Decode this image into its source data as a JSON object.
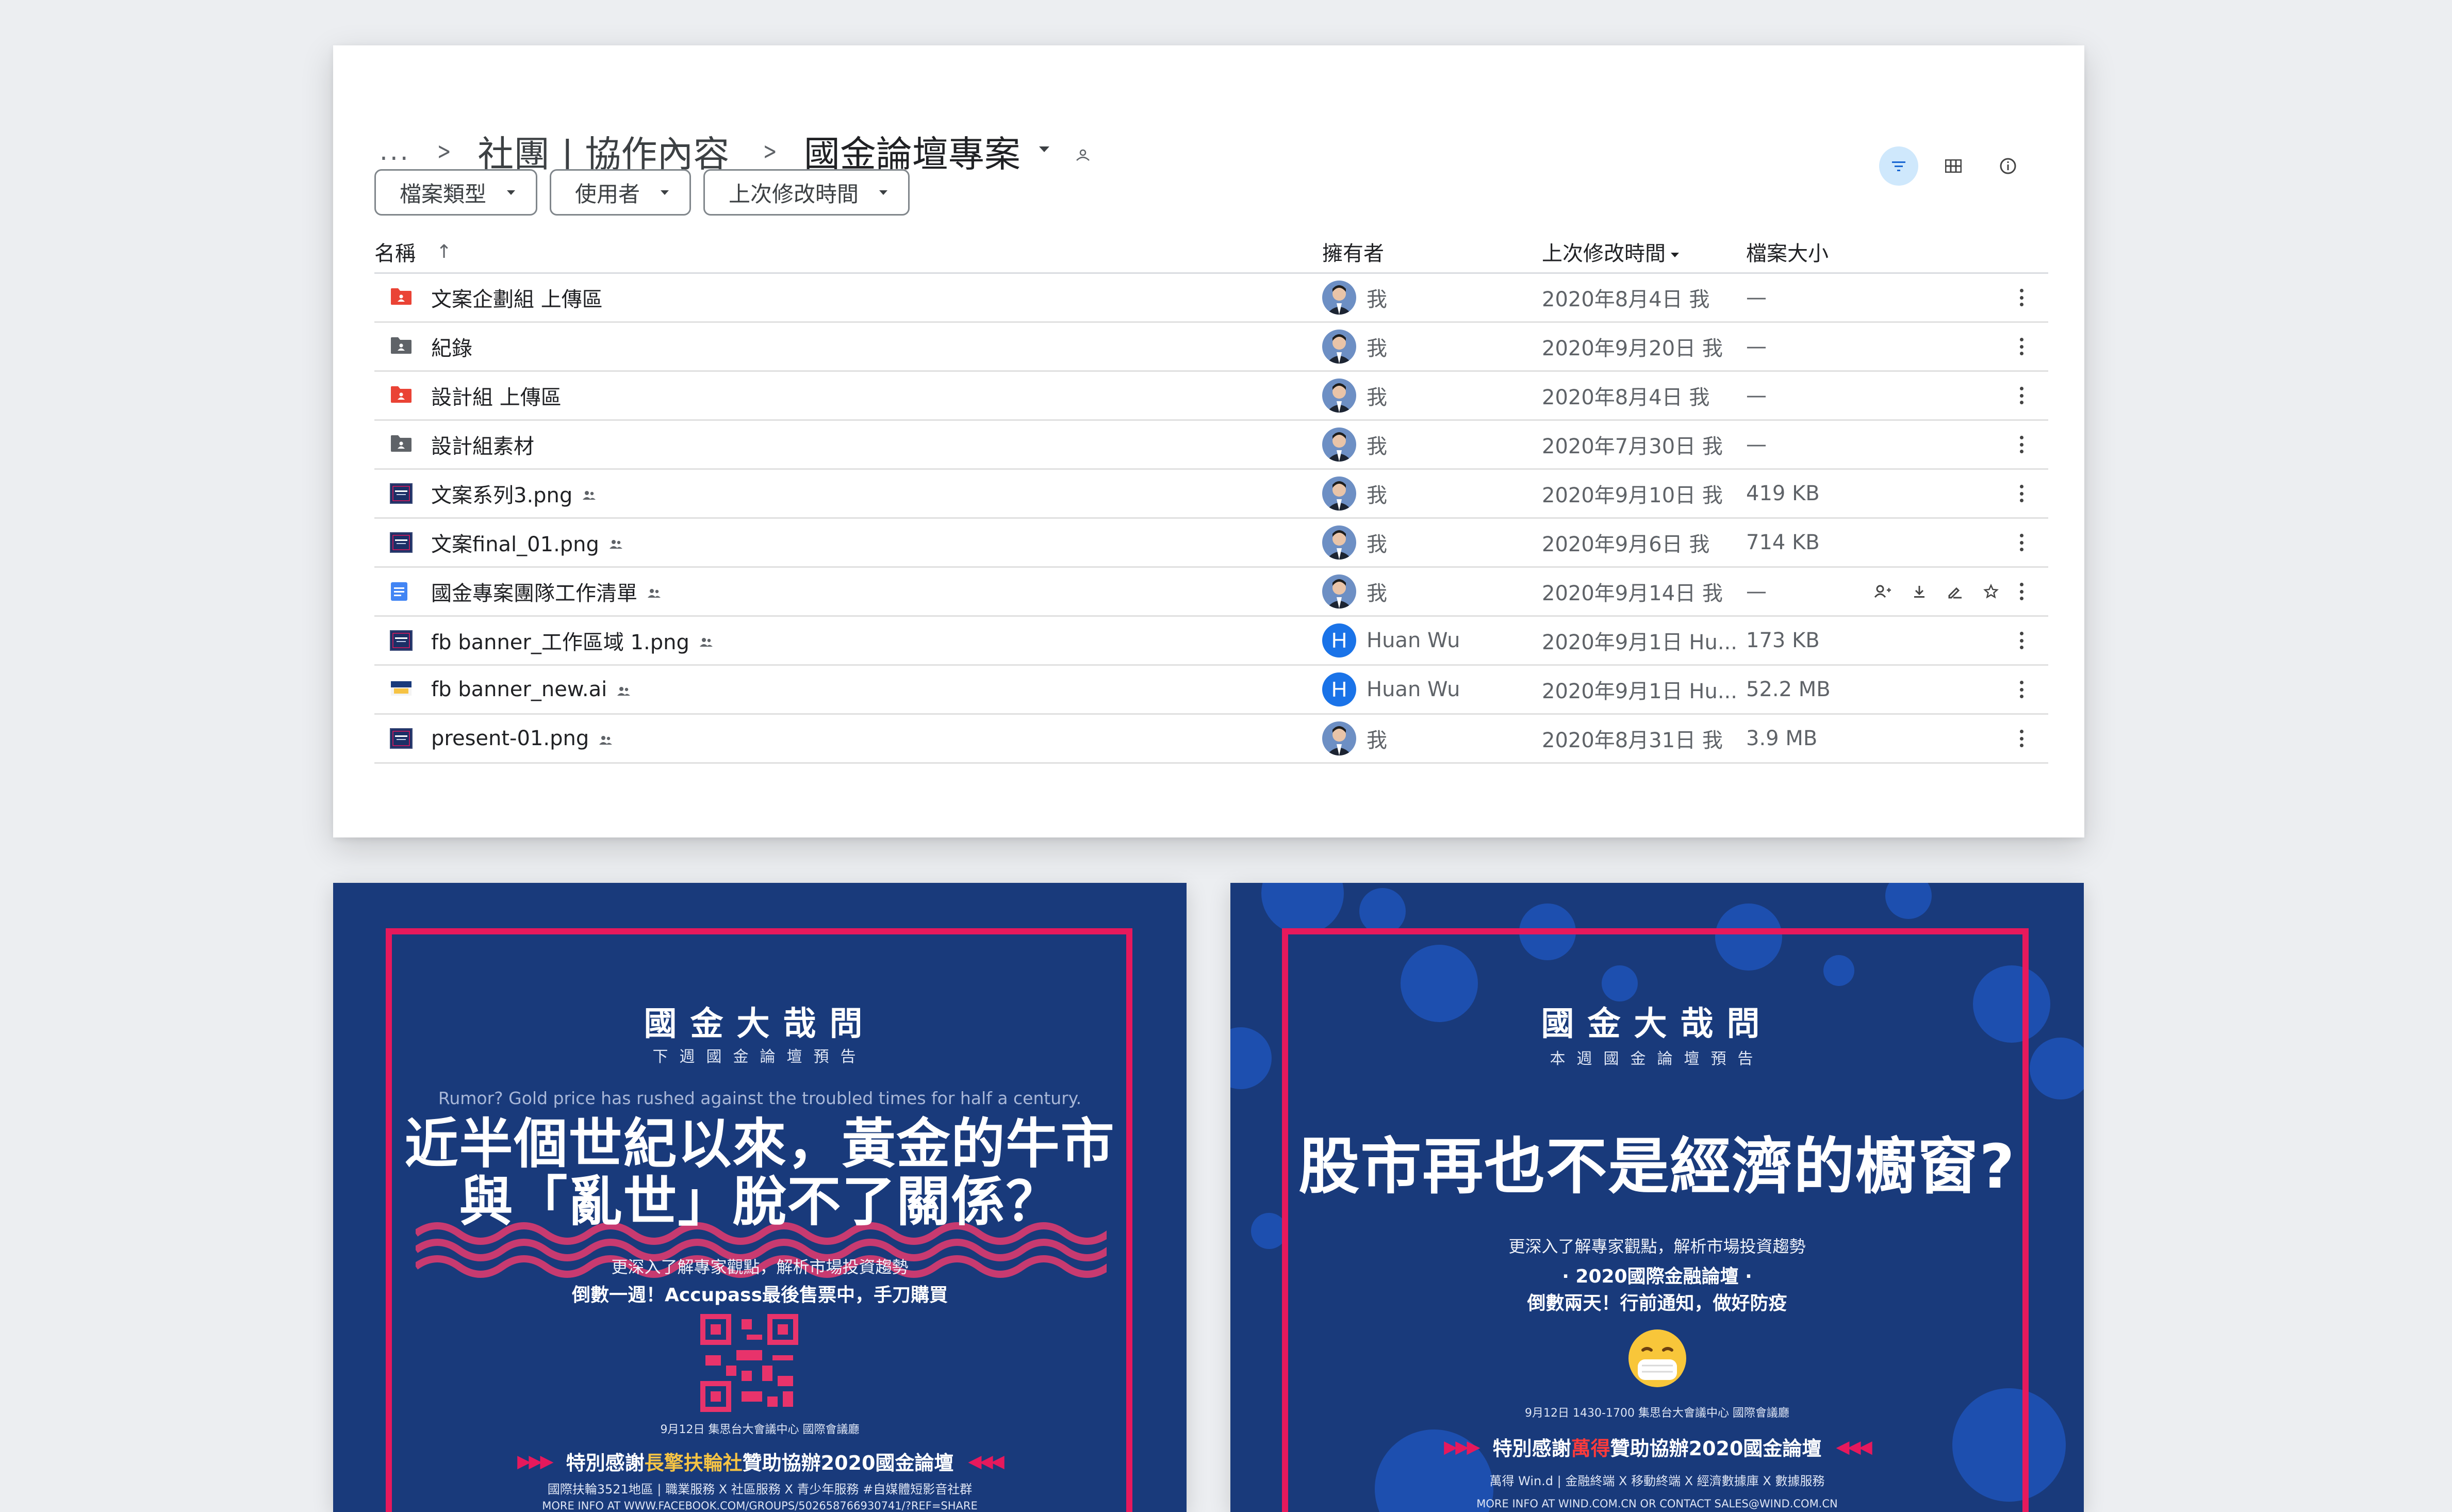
{
  "breadcrumb": {
    "more": "...",
    "parent": "社團 | 協作內容",
    "current": "國金論壇專案"
  },
  "filters": [
    "檔案類型",
    "使用者",
    "上次修改時間"
  ],
  "columns": {
    "name": "名稱",
    "sort_arrow": "↑",
    "owner": "擁有者",
    "modified": "上次修改時間",
    "size": "檔案大小"
  },
  "files": [
    {
      "name": "文案企劃組 上傳區",
      "type": "shared-folder-red",
      "shared": false,
      "owner": "我",
      "owner_type": "photo",
      "modified": "2020年8月4日 我",
      "size": "—"
    },
    {
      "name": "紀錄",
      "type": "shared-folder-gray",
      "shared": false,
      "owner": "我",
      "owner_type": "photo",
      "modified": "2020年9月20日 我",
      "size": "—"
    },
    {
      "name": "設計組 上傳區",
      "type": "shared-folder-red",
      "shared": false,
      "owner": "我",
      "owner_type": "photo",
      "modified": "2020年8月4日 我",
      "size": "—"
    },
    {
      "name": "設計組素材",
      "type": "shared-folder-gray",
      "shared": false,
      "owner": "我",
      "owner_type": "photo",
      "modified": "2020年7月30日 我",
      "size": "—"
    },
    {
      "name": "文案系列3.png",
      "type": "image",
      "shared": true,
      "owner": "我",
      "owner_type": "photo",
      "modified": "2020年9月10日 我",
      "size": "419 KB"
    },
    {
      "name": "文案final_01.png",
      "type": "image",
      "shared": true,
      "owner": "我",
      "owner_type": "photo",
      "modified": "2020年9月6日 我",
      "size": "714 KB"
    },
    {
      "name": "國金專案團隊工作清單",
      "type": "doc",
      "shared": true,
      "owner": "我",
      "owner_type": "photo",
      "modified": "2020年9月14日 我",
      "size": "—",
      "hovered": true
    },
    {
      "name": "fb banner_工作區域 1.png",
      "type": "image",
      "shared": true,
      "owner": "Huan Wu",
      "owner_type": "letter",
      "owner_initial": "H",
      "modified": "2020年9月1日 Hu...",
      "size": "173 KB"
    },
    {
      "name": "fb banner_new.ai",
      "type": "ai",
      "shared": true,
      "owner": "Huan Wu",
      "owner_type": "letter",
      "owner_initial": "H",
      "modified": "2020年9月1日 Hu...",
      "size": "52.2 MB"
    },
    {
      "name": "present-01.png",
      "type": "image",
      "shared": true,
      "owner": "我",
      "owner_type": "photo",
      "modified": "2020年8月31日 我",
      "size": "3.9 MB"
    }
  ],
  "posters": {
    "left": {
      "title": "國金大哉問",
      "subtitle": "下週國金論壇預告",
      "english": "Rumor? Gold price has rushed against the troubled times for half a century.",
      "headline_1": "近半個世紀以來，黃金的牛市",
      "headline_2": "與「亂世」脫不了關係？",
      "line_1": "更深入了解專家觀點，解析市場投資趨勢",
      "line_2": "倒數一週！Accupass最後售票中，手刀購買",
      "date": "9月12日 集思台大會議中心 國際會議廳",
      "thanks_pre": "特別感謝",
      "thanks_hl": "長擎扶輪社",
      "thanks_post": "贊助協辦2020國金論壇",
      "sponsors": "國際扶輪3521地區 | 職業服務 X 社區服務 X 青少年服務 #自媒體短影音社群",
      "more_info": "MORE INFO AT WWW.FACEBOOK.COM/GROUPS/502658766930741/?REF=SHARE"
    },
    "right": {
      "title": "國金大哉問",
      "subtitle": "本週國金論壇預告",
      "headline": "股市再也不是經濟的櫥窗?",
      "line_1": "更深入了解專家觀點，解析市場投資趨勢",
      "line_2": "· 2020國際金融論壇 ·",
      "line_3": "倒數兩天！行前通知，做好防疫",
      "emoji": "😷",
      "date": "9月12日 1430-1700 集思台大會議中心 國際會議廳",
      "thanks_pre": "特別感謝",
      "thanks_hl": "萬得",
      "thanks_post": "贊助協辦2020國金論壇",
      "sponsors": "萬得 Win.d | 金融終端 X 移動終端 X 經濟數據庫 X 數據服務",
      "more_info": "MORE INFO AT WIND.COM.CN OR CONTACT SALES@WIND.COM.CN"
    }
  },
  "colors": {
    "accent": "#1a73e8",
    "poster_bg": "#193a7b",
    "poster_frame": "#e6195c",
    "highlight_yellow": "#f6c344",
    "highlight_red": "#ff3b3b"
  }
}
